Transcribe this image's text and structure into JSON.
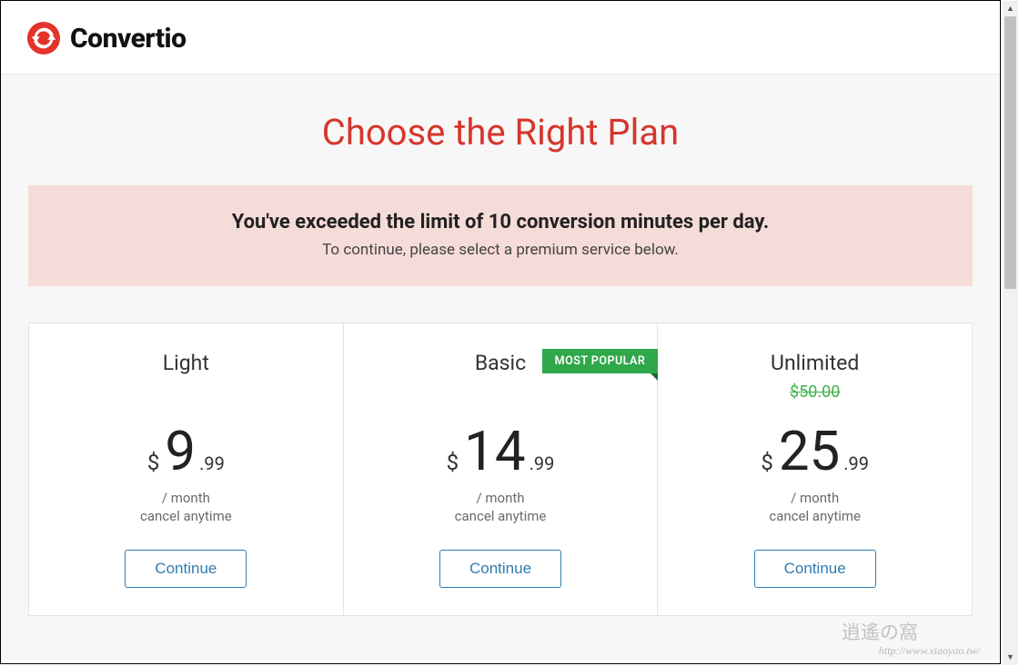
{
  "brand": "Convertio",
  "page_title": "Choose the Right Plan",
  "alert": {
    "strong": "You've exceeded the limit of 10 conversion minutes per day.",
    "sub": "To continue, please select a premium service below."
  },
  "badge": "MOST POPULAR",
  "common": {
    "currency": "$",
    "period": "/ month",
    "cancel": "cancel anytime",
    "cta": "Continue"
  },
  "plans": [
    {
      "name": "Light",
      "old_price": "",
      "main": "9",
      "cents": ".99"
    },
    {
      "name": "Basic",
      "old_price": "",
      "main": "14",
      "cents": ".99",
      "popular": true
    },
    {
      "name": "Unlimited",
      "old_price": "$50.00",
      "main": "25",
      "cents": ".99"
    }
  ],
  "watermark": {
    "ch": "逍遙の窩",
    "url": "http://www.xiaoyao.tw/"
  }
}
